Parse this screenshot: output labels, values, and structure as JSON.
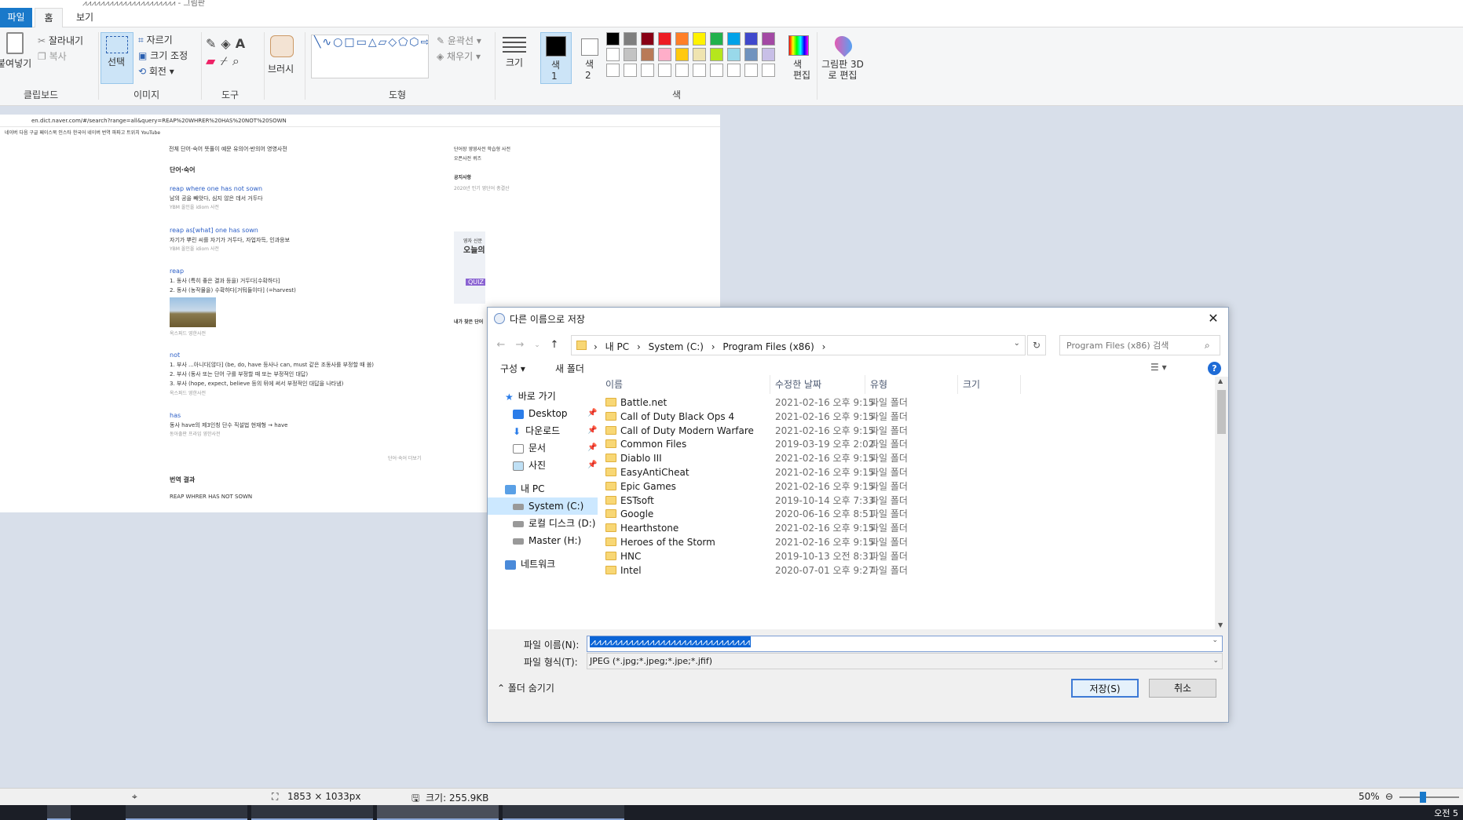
{
  "app": {
    "title_fragment": "⩘⩘⩘⩘⩘⩘⩘⩘⩘⩘⩘⩘⩘⩘⩘⩘⩘⩘⩘⩘⩘ - 그림판"
  },
  "ribbon": {
    "tabs": [
      "파일",
      "홈",
      "보기"
    ],
    "clipboard": {
      "paste": "붙여넣기",
      "cut": "잘라내기",
      "copy": "복사",
      "group": "클립보드"
    },
    "image": {
      "select": "선택",
      "crop": "자르기",
      "resize": "크기 조정",
      "rotate": "회전",
      "group": "이미지"
    },
    "tools": {
      "group": "도구"
    },
    "brush": {
      "label": "브러시"
    },
    "shapes": {
      "outline": "윤곽선",
      "fill": "채우기",
      "group": "도형"
    },
    "size": {
      "label": "크기"
    },
    "colors": {
      "color1": "색\n1",
      "color2": "색\n2",
      "edit": "색\n편집",
      "group": "색",
      "palette_row1": [
        "#000000",
        "#7f7f7f",
        "#880015",
        "#ed1c24",
        "#ff7f27",
        "#fff200",
        "#22b14c",
        "#00a2e8",
        "#3f48cc",
        "#a349a4"
      ],
      "palette_row2": [
        "#ffffff",
        "#c3c3c3",
        "#b97a57",
        "#ffaec9",
        "#ffc90e",
        "#efe4b0",
        "#b5e61d",
        "#99d9ea",
        "#7092be",
        "#c8bfe7"
      ]
    },
    "paint3d": {
      "label": "그림판 3D로 편집"
    }
  },
  "pasted_screenshot": {
    "url": "en.dict.naver.com/#/search?range=all&query=REAP%20WHRER%20HAS%20NOT%20SOWN",
    "bookmarks": "네이버   다음   구글   페이스북   인스타   한국어   네이버 번역   파파고   트위치   YouTube",
    "tabs": "전체    단어·숙어    뜻풀이    예문    유의어·반의어    영영사전",
    "section_title": "단어·숙어",
    "entries": [
      {
        "term": "reap where one has not sown",
        "meaning": "남의 공을 빼앗다, 심지 않은 데서 거두다",
        "source": "YBM 올인올 idiom 사전"
      },
      {
        "term": "reap as[what] one has sown",
        "meaning": "자기가 뿌린 씨를 자기가 거두다, 자업자득, 인과응보",
        "source": "YBM 올인올 idiom 사전"
      },
      {
        "term": "reap",
        "meaning": "1. 동사 (특히 좋은 결과 등을) 거두다[수확하다]",
        "meaning2": "2. 동사 (농작물을) 수확하다[거둬들이다] (=harvest)",
        "source": "옥스퍼드 영한사전"
      },
      {
        "term": "not",
        "meaning": "1. 부사 ...아니다[않다] (be, do, have 등사나 can, must 같은 조동사를 부정할 때 씀)",
        "meaning2": "2. 부사 (동사 또는 단어 구를 부정할 때 또는 부정적인 대답)",
        "meaning3": "3. 부사 (hope, expect, believe 등의 뒤에 써서 부정적인 대답을 나타냄)",
        "source": "옥스퍼드 영한사전"
      },
      {
        "term": "has",
        "meaning": "동사 have의 제3인칭 단수 직설법 현재형 → have",
        "source": "동아출판 프라임 영한사전"
      }
    ],
    "more_link": "단어·숙어 더보기",
    "translation_title": "번역 결과",
    "translation_text": "REAP WHRER HAS NOT SOWN",
    "right_panel": {
      "tabs": "단어장   영영사전   학습형 사전",
      "tabs2": "오픈사전   퀴즈",
      "notice": "공지사항",
      "notice_text": "2020년 인기 영단어 총결산",
      "ad_title": "오늘의",
      "ad_sub": "영자 신문",
      "quiz": "QUIZ",
      "recent": "내가 찾은 단어"
    }
  },
  "dialog": {
    "title": "다른 이름으로 저장",
    "breadcrumb": [
      "내 PC",
      "System (C:)",
      "Program Files (x86)"
    ],
    "search_placeholder": "Program Files (x86) 검색",
    "organize": "구성",
    "new_folder": "새 폴더",
    "nav": {
      "quick_access": "바로 가기",
      "desktop": "Desktop",
      "downloads": "다운로드",
      "documents": "문서",
      "pictures": "사진",
      "this_pc": "내 PC",
      "system_c": "System (C:)",
      "local_d": "로컬 디스크 (D:)",
      "master_h": "Master (H:)",
      "network": "네트워크"
    },
    "columns": {
      "name": "이름",
      "date": "수정한 날짜",
      "type": "유형",
      "size": "크기"
    },
    "files": [
      {
        "name": "Battle.net",
        "date": "2021-02-16 오후 9:15",
        "type": "파일 폴더"
      },
      {
        "name": "Call of Duty Black Ops 4",
        "date": "2021-02-16 오후 9:15",
        "type": "파일 폴더"
      },
      {
        "name": "Call of Duty Modern Warfare",
        "date": "2021-02-16 오후 9:15",
        "type": "파일 폴더"
      },
      {
        "name": "Common Files",
        "date": "2019-03-19 오후 2:02",
        "type": "파일 폴더"
      },
      {
        "name": "Diablo III",
        "date": "2021-02-16 오후 9:15",
        "type": "파일 폴더"
      },
      {
        "name": "EasyAntiCheat",
        "date": "2021-02-16 오후 9:15",
        "type": "파일 폴더"
      },
      {
        "name": "Epic Games",
        "date": "2021-02-16 오후 9:15",
        "type": "파일 폴더"
      },
      {
        "name": "ESTsoft",
        "date": "2019-10-14 오후 7:33",
        "type": "파일 폴더"
      },
      {
        "name": "Google",
        "date": "2020-06-16 오후 8:51",
        "type": "파일 폴더"
      },
      {
        "name": "Hearthstone",
        "date": "2021-02-16 오후 9:15",
        "type": "파일 폴더"
      },
      {
        "name": "Heroes of the Storm",
        "date": "2021-02-16 오후 9:15",
        "type": "파일 폴더"
      },
      {
        "name": "HNC",
        "date": "2019-10-13 오전 8:31",
        "type": "파일 폴더"
      },
      {
        "name": "Intel",
        "date": "2020-07-01 오후 9:27",
        "type": "파일 폴더"
      }
    ],
    "filename_label": "파일 이름(N):",
    "filename_value": "⩘⩘⩘⩘⩘⩘⩘⩘⩘⩘⩘⩘⩘⩘⩘⩘⩘⩘⩘⩘⩘⩘⩘⩘⩘⩘⩘⩘⩘⩘",
    "filetype_label": "파일 형식(T):",
    "filetype_value": "JPEG (*.jpg;*.jpeg;*.jpe;*.jfif)",
    "hide_folders": "폴더 숨기기",
    "save": "저장(S)",
    "cancel": "취소"
  },
  "statusbar": {
    "dimensions": "1853 × 1033px",
    "size": "크기: 255.9KB",
    "zoom": "50%"
  },
  "taskbar": {
    "clock": "오전 5"
  }
}
